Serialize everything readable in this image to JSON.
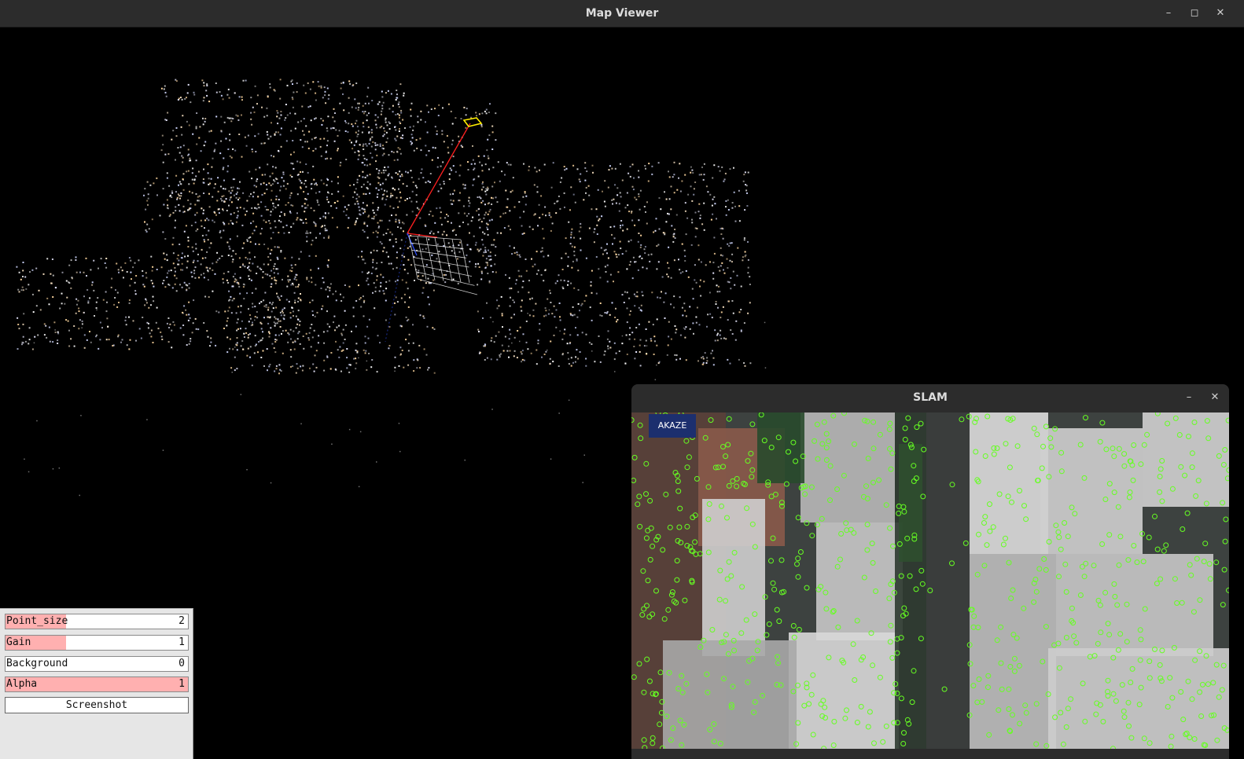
{
  "main_window": {
    "title": "Map Viewer",
    "controls": {
      "minimize": "–",
      "maximize": "◻",
      "close": "✕"
    }
  },
  "panel": {
    "sliders": [
      {
        "label": "Point_size",
        "value": "2",
        "fill": 0.33
      },
      {
        "label": "Gain",
        "value": "1",
        "fill": 0.33
      },
      {
        "label": "Background",
        "value": "0",
        "fill": 0.0
      },
      {
        "label": "Alpha",
        "value": "1",
        "fill": 1.0
      }
    ],
    "screenshot_label": "Screenshot"
  },
  "slam_window": {
    "title": "SLAM",
    "controls": {
      "minimize": "–",
      "close": "✕"
    },
    "badge": "AKAZE"
  },
  "colors": {
    "titlebar": "#2c2c2c",
    "slider_fill": "#ffb0b0",
    "feature": "#66ff22",
    "camera_path": "#ff2020",
    "camera_frustum": "#ffee00",
    "grid": "#ffffff"
  },
  "icons": [
    "minimize-icon",
    "maximize-icon",
    "close-icon"
  ]
}
